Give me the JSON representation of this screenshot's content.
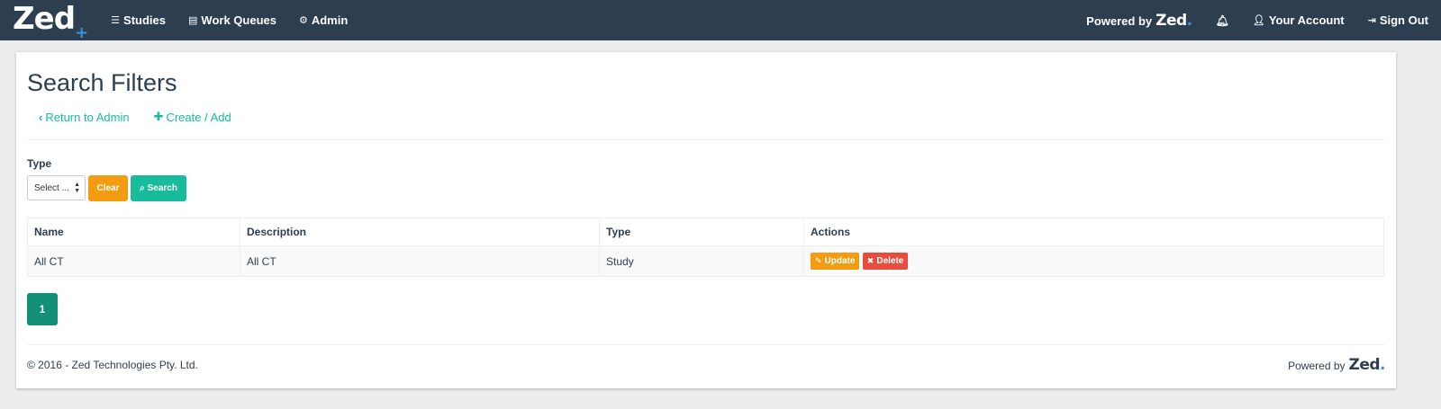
{
  "nav": {
    "brand": "Zed",
    "brand_accent": "+",
    "items": [
      {
        "icon": "list-icon",
        "label": "Studies"
      },
      {
        "icon": "table-icon",
        "label": "Work Queues"
      },
      {
        "icon": "cogs-icon",
        "label": "Admin"
      }
    ],
    "powered_prefix": "Powered by",
    "powered_brand": "Zed",
    "powered_dot": ".",
    "account": "Your Account",
    "signout": "Sign Out"
  },
  "page": {
    "title": "Search Filters",
    "return_link": "Return to Admin",
    "create_link": "Create / Add"
  },
  "filters": {
    "type_label": "Type",
    "select_value": "Select ...",
    "clear_label": "Clear",
    "search_label": "Search"
  },
  "table": {
    "headers": [
      "Name",
      "Description",
      "Type",
      "Actions"
    ],
    "rows": [
      {
        "name": "All CT",
        "description": "All CT",
        "type": "Study",
        "update": "Update",
        "delete": "Delete"
      }
    ]
  },
  "pagination": {
    "current": "1"
  },
  "footer": {
    "copyright": "© 2016 - Zed Technologies Pty. Ltd.",
    "powered_prefix": "Powered by",
    "powered_brand": "Zed",
    "powered_dot": "."
  },
  "colors": {
    "navbar": "#2c3e50",
    "accent": "#18bc9c",
    "warning": "#f39c12",
    "danger": "#e74c3c",
    "brand_blue": "#3498db"
  }
}
